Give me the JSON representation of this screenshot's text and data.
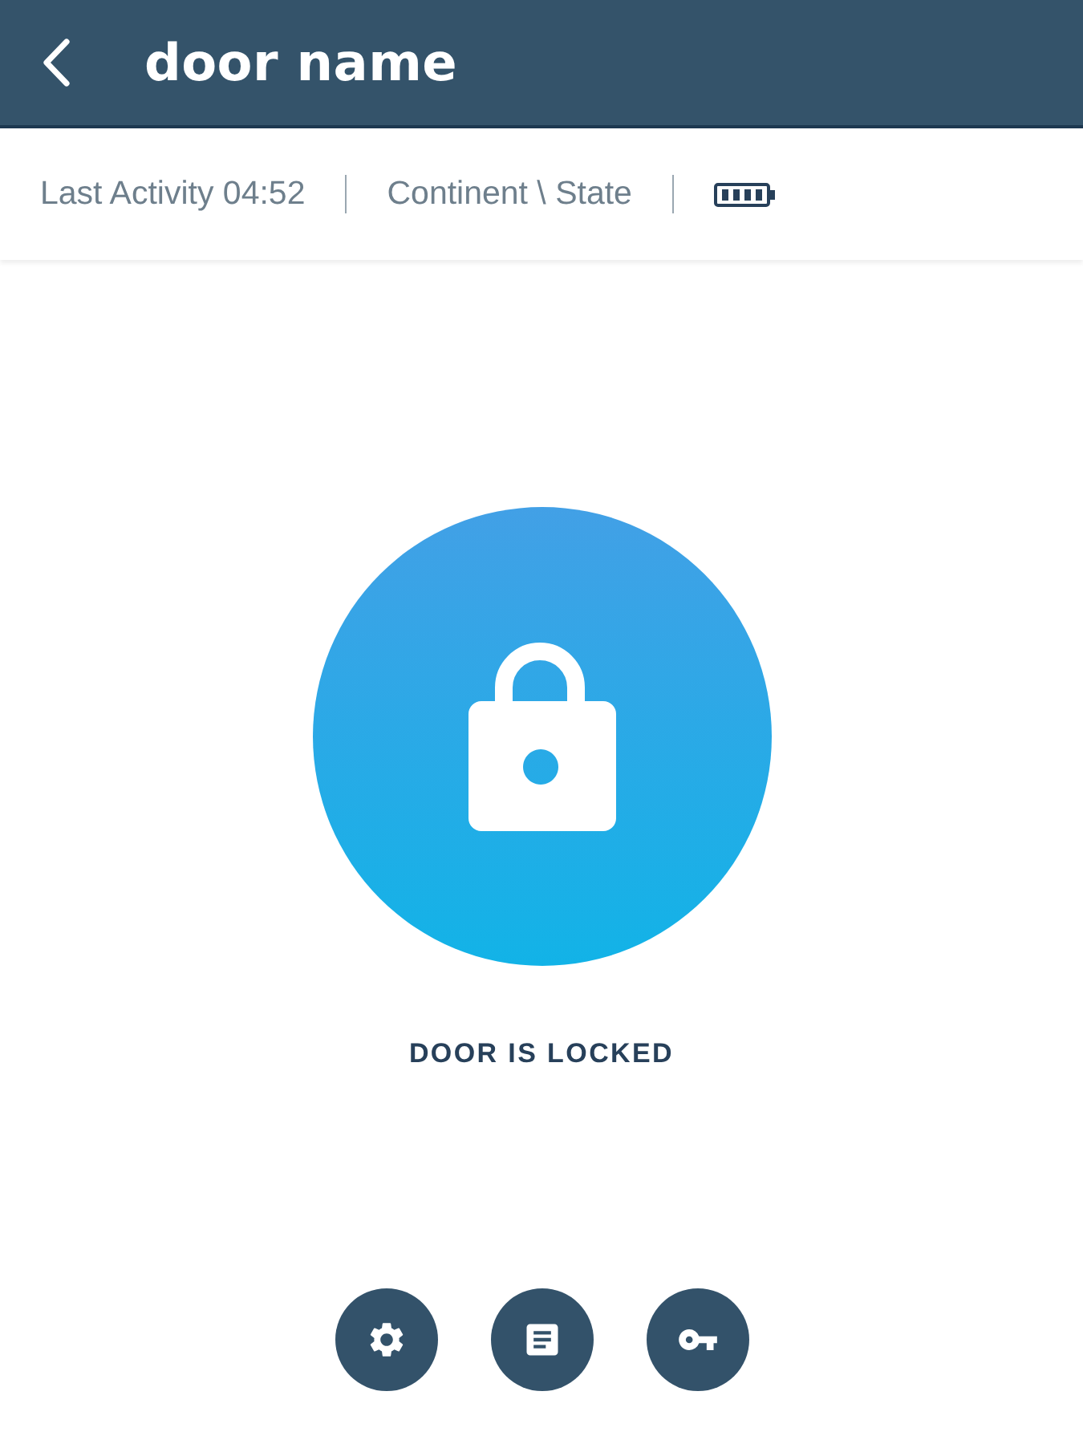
{
  "header": {
    "title": "door name"
  },
  "info_bar": {
    "last_activity": "Last Activity 04:52",
    "location": "Continent \\ State"
  },
  "lock": {
    "locked": true,
    "status": "DOOR IS LOCKED"
  },
  "actions": [
    {
      "kind": "settings"
    },
    {
      "kind": "log"
    },
    {
      "kind": "key"
    }
  ]
}
